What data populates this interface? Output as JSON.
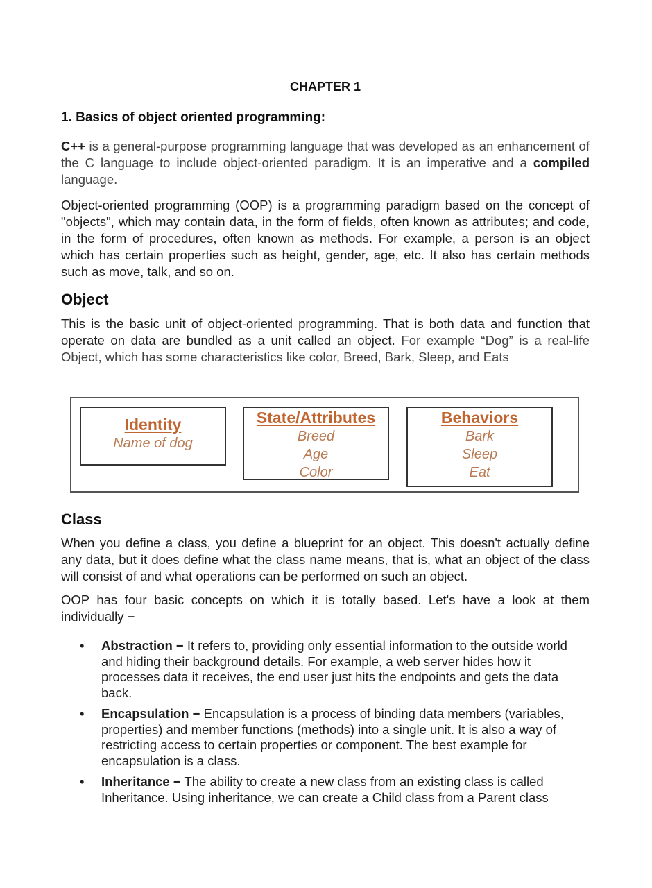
{
  "chapter_title": "CHAPTER 1",
  "section_heading": "1.  Basics of object oriented programming:",
  "intro": {
    "lead_bold": "C++",
    "text_1": " is a general-purpose programming language that was developed as an enhancement of the C language to include object-oriented paradigm. It is an imperative and a ",
    "bold_word": "compiled",
    "text_2": " language."
  },
  "oop_paragraph": "Object-oriented programming (OOP) is a programming paradigm based on the concept of \"objects\", which may contain data, in the form of fields, often known as attributes; and code, in the form of procedures, often known as methods. For example, a person is an object which has certain properties such as height, gender, age, etc. It also has certain methods such as move, talk, and so on.",
  "object_section": {
    "heading": "Object",
    "text_dark": "This is the basic unit of object-oriented programming. That is both data and function that operate on data are bundled as a unit called an object. ",
    "text_gray": "For example “Dog” is a real-life Object, which has some characteristics like color, Breed, Bark, Sleep, and Eats"
  },
  "diagram": {
    "accent_color": "#c0652f",
    "boxes": [
      {
        "title": "Identity",
        "items": [
          "Name of dog"
        ]
      },
      {
        "title": "State/Attributes",
        "items": [
          "Breed",
          "Age",
          "Color"
        ]
      },
      {
        "title": "Behaviors",
        "items": [
          "Bark",
          "Sleep",
          "Eat"
        ]
      }
    ]
  },
  "class_section": {
    "heading": "Class",
    "paragraph": "When you define a class, you define a blueprint for an object. This doesn't actually define any data, but it does define what the class name means, that is, what an object of the class will consist of and what operations can be performed on such an object.",
    "concepts_intro": "OOP has four basic concepts on which it is totally based. Let's have a look at them individually −"
  },
  "concepts": [
    {
      "term": "Abstraction −",
      "text": " It refers to, providing only essential information to the outside world and hiding their background details. For example, a web server hides how it processes data it receives, the end user just hits the endpoints and gets the data back."
    },
    {
      "term": "Encapsulation −",
      "text": " Encapsulation is a process of binding data members (variables, properties) and member functions (methods) into a single unit. It is also a way of restricting access to certain properties or component. The best example for encapsulation is a class."
    },
    {
      "term": "Inheritance −",
      "text": " The ability to create a new class from an existing class is called Inheritance. Using inheritance, we can create a Child class from a Parent class"
    }
  ],
  "bullet_glyph": "•"
}
